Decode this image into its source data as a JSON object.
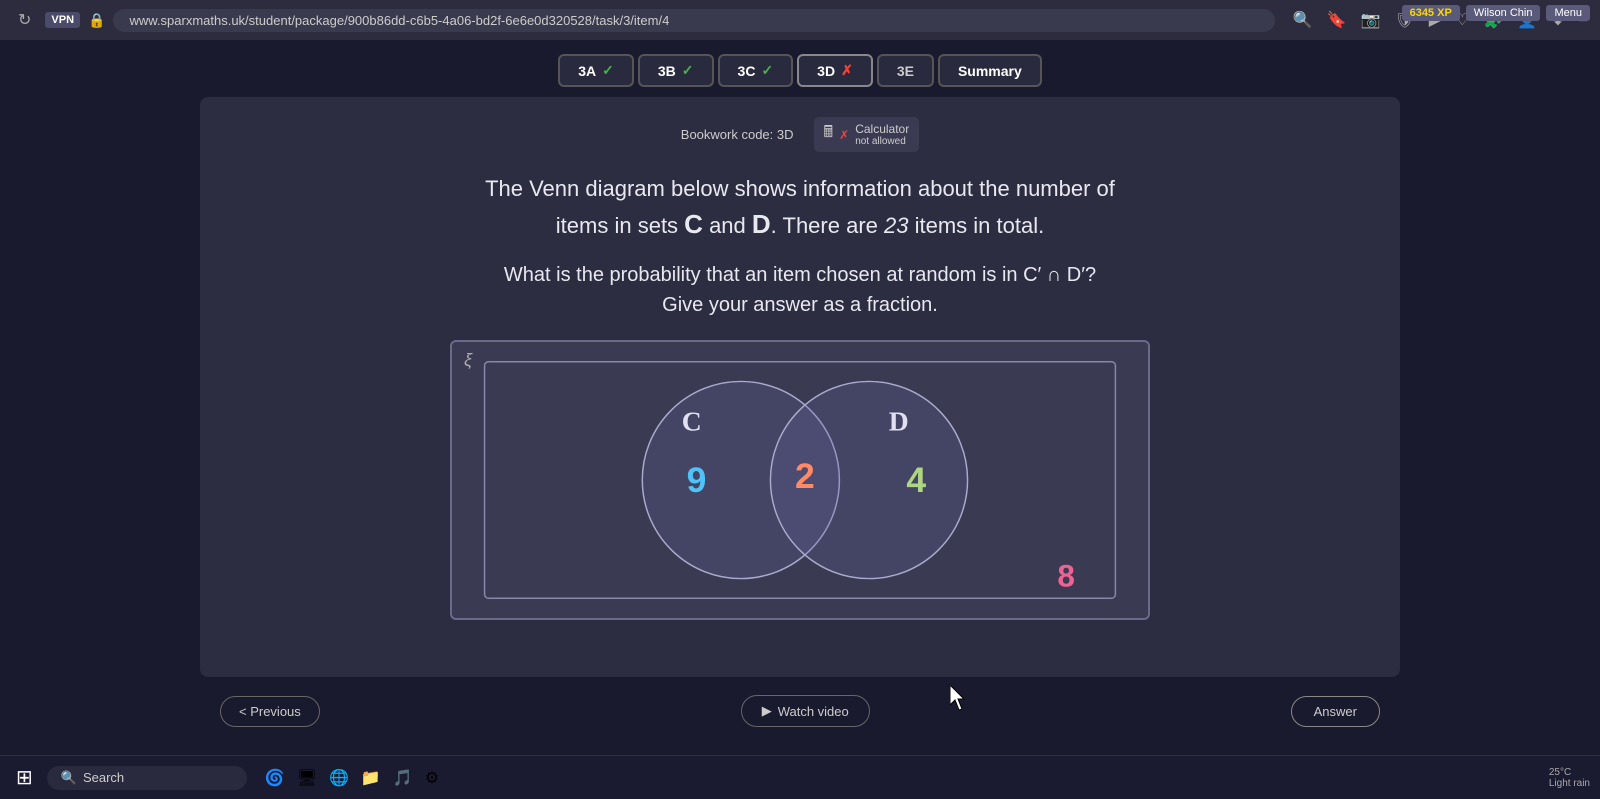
{
  "browser": {
    "url": "www.sparxmaths.uk/student/package/900b86dd-c6b5-4a06-bd2f-6e6e0d320528/task/3/item/4",
    "vpn_label": "VPN"
  },
  "user": {
    "xp": "6345 XP",
    "name": "Wilson Chin",
    "menu": "Menu"
  },
  "tabs": [
    {
      "label": "3A",
      "status": "check",
      "symbol": "✓"
    },
    {
      "label": "3B",
      "status": "check",
      "symbol": "✓"
    },
    {
      "label": "3C",
      "status": "check",
      "symbol": "✓"
    },
    {
      "label": "3D",
      "status": "cross",
      "symbol": "✗"
    },
    {
      "label": "3E",
      "status": "none",
      "symbol": ""
    },
    {
      "label": "Summary",
      "status": "none",
      "symbol": ""
    }
  ],
  "bookwork": {
    "code_label": "Bookwork code: 3D",
    "calculator_label": "Calculator",
    "calculator_status": "not allowed"
  },
  "question": {
    "line1": "The Venn diagram below shows information about the number of",
    "line2": "items in sets C and D. There are 23 items in total.",
    "line3": "What is the probability that an item chosen at random is in C′ ∩ D′?",
    "line4": "Give your answer as a fraction."
  },
  "venn": {
    "xi_symbol": "ξ",
    "set_c_label": "C",
    "set_d_label": "D",
    "c_only_value": "9",
    "intersection_value": "2",
    "d_only_value": "4",
    "outside_value": "8",
    "c_only_color": "#4fc3f7",
    "intersection_color": "#ff8a65",
    "d_only_color": "#aed581",
    "outside_color": "#f06292"
  },
  "controls": {
    "previous_label": "< Previous",
    "watch_video_label": "Watch video",
    "answer_label": "Answer"
  },
  "taskbar": {
    "search_placeholder": "Search",
    "weather_temp": "25°C",
    "weather_desc": "Light rain"
  }
}
